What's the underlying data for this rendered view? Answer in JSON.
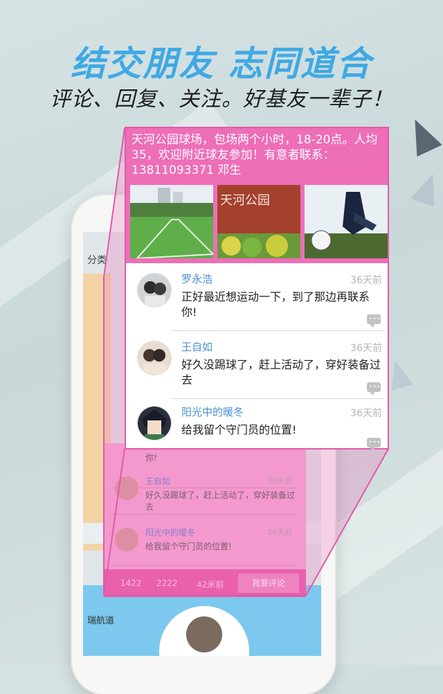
{
  "headline": "结交朋友 志同道合",
  "subline": "评论、回复、关注。好基友一辈子！",
  "colors": {
    "accent_blue": "#3fa9e4",
    "pink": "#ee6eb8",
    "pink_border": "#e05aa8"
  },
  "post": {
    "text": "天河公园球场，包场两个小时，18-20点。人均35，欢迎附近球友参加！有意者联系：13811093371 邓生",
    "photos": [
      "football-field-photo",
      "tianhe-park-sign-photo",
      "football-kick-photo"
    ],
    "photo_sign_text": "天河公园"
  },
  "comments": [
    {
      "name": "罗永浩",
      "time": "36天前",
      "text": "正好最近想运动一下，到了那边再联系你!",
      "reply_icon": "comment-bubble-icon"
    },
    {
      "name": "王自如",
      "time": "36天前",
      "text": "好久没踢球了，赶上活动了，穿好装备过去",
      "reply_icon": "comment-bubble-icon"
    },
    {
      "name": "阳光中的暖冬",
      "time": "36天前",
      "text": "给我留个守门员的位置!",
      "reply_icon": "comment-bubble-icon"
    }
  ],
  "background_screen": {
    "top_label": "分类",
    "mini_comments": [
      {
        "name": "",
        "text": "你!",
        "time": ""
      },
      {
        "name": "王自如",
        "text": "好久没踢球了，赶上活动了，穿好装备过去",
        "time": "36天前"
      },
      {
        "name": "阳光中的暖冬",
        "text": "给我留个守门员的位置!",
        "time": "36天前"
      }
    ],
    "footer": {
      "likes": "1422",
      "comments": "2222",
      "distance": "42米前",
      "comment_button": "我要评论"
    },
    "map_label": "瑞航道"
  }
}
